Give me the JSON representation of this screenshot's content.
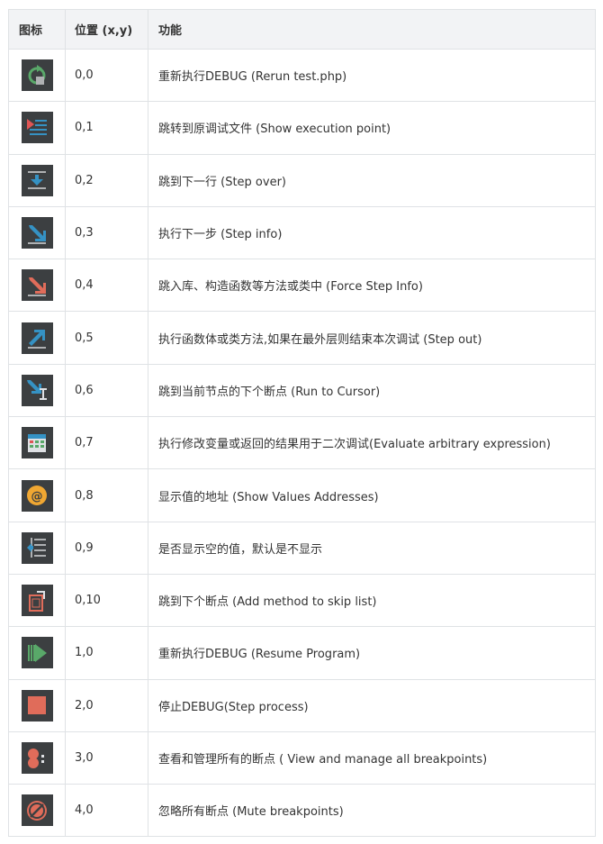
{
  "header": {
    "col_icon": "图标",
    "col_pos": "位置 (x,y)",
    "col_func": "功能"
  },
  "rows": [
    {
      "icon": "rerun-icon",
      "pos": "0,0",
      "func": "重新执行DEBUG (Rerun test.php)"
    },
    {
      "icon": "show-execution-point-icon",
      "pos": "0,1",
      "func": "跳转到原调试文件 (Show execution point)"
    },
    {
      "icon": "step-over-icon",
      "pos": "0,2",
      "func": "跳到下一行 (Step over)"
    },
    {
      "icon": "step-into-icon",
      "pos": "0,3",
      "func": "执行下一步 (Step info)"
    },
    {
      "icon": "force-step-into-icon",
      "pos": "0,4",
      "func": "跳入库、构造函数等方法或类中 (Force Step Info)"
    },
    {
      "icon": "step-out-icon",
      "pos": "0,5",
      "func": "执行函数体或类方法,如果在最外层则结束本次调试 (Step out)"
    },
    {
      "icon": "run-to-cursor-icon",
      "pos": "0,6",
      "func": "跳到当前节点的下个断点 (Run to Cursor)"
    },
    {
      "icon": "evaluate-expression-icon",
      "pos": "0,7",
      "func": "执行修改变量或返回的结果用于二次调试(Evaluate arbitrary expression)"
    },
    {
      "icon": "show-values-addresses-icon",
      "pos": "0,8",
      "func": "显示值的地址 (Show Values Addresses)"
    },
    {
      "icon": "show-empty-values-icon",
      "pos": "0,9",
      "func": "是否显示空的值，默认是不显示"
    },
    {
      "icon": "add-to-skip-list-icon",
      "pos": "0,10",
      "func": "跳到下个断点 (Add method to skip list)"
    },
    {
      "icon": "resume-program-icon",
      "pos": "1,0",
      "func": "重新执行DEBUG (Resume Program)"
    },
    {
      "icon": "stop-icon",
      "pos": "2,0",
      "func": "停止DEBUG(Step process)"
    },
    {
      "icon": "view-breakpoints-icon",
      "pos": "3,0",
      "func": "查看和管理所有的断点 ( View and manage all breakpoints)"
    },
    {
      "icon": "mute-breakpoints-icon",
      "pos": "4,0",
      "func": "忽略所有断点 (Mute breakpoints)"
    }
  ]
}
